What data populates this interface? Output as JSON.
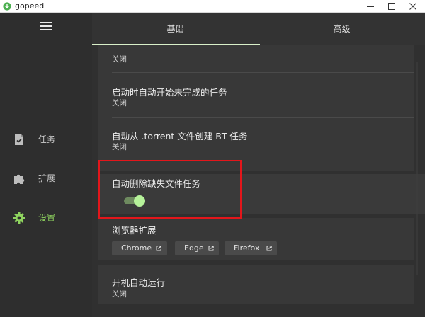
{
  "window": {
    "title": "gopeed"
  },
  "sidebar": {
    "items": [
      {
        "label": "任务",
        "icon": "task-file-icon",
        "active": false
      },
      {
        "label": "扩展",
        "icon": "puzzle-icon",
        "active": false
      },
      {
        "label": "设置",
        "icon": "gear-icon",
        "active": true
      }
    ]
  },
  "tabs": [
    {
      "label": "基础",
      "active": true
    },
    {
      "label": "高级",
      "active": false
    }
  ],
  "settings": {
    "top_partial": {
      "value": "关闭"
    },
    "auto_start_unfinished": {
      "title": "启动时自动开始未完成的任务",
      "value": "关闭"
    },
    "auto_create_from_torrent": {
      "title": "自动从 .torrent 文件创建 BT 任务",
      "value": "关闭"
    },
    "auto_delete_missing": {
      "title": "自动删除缺失文件任务",
      "enabled": true
    },
    "browser_extension": {
      "title": "浏览器扩展",
      "buttons": [
        {
          "label": "Chrome"
        },
        {
          "label": "Edge"
        },
        {
          "label": "Firefox"
        }
      ]
    },
    "launch_at_startup": {
      "title": "开机自动运行",
      "value": "关闭"
    }
  },
  "colors": {
    "accent": "#8fd45f",
    "toggle_thumb": "#b6f29a",
    "annotation_box": "#e3161b"
  }
}
